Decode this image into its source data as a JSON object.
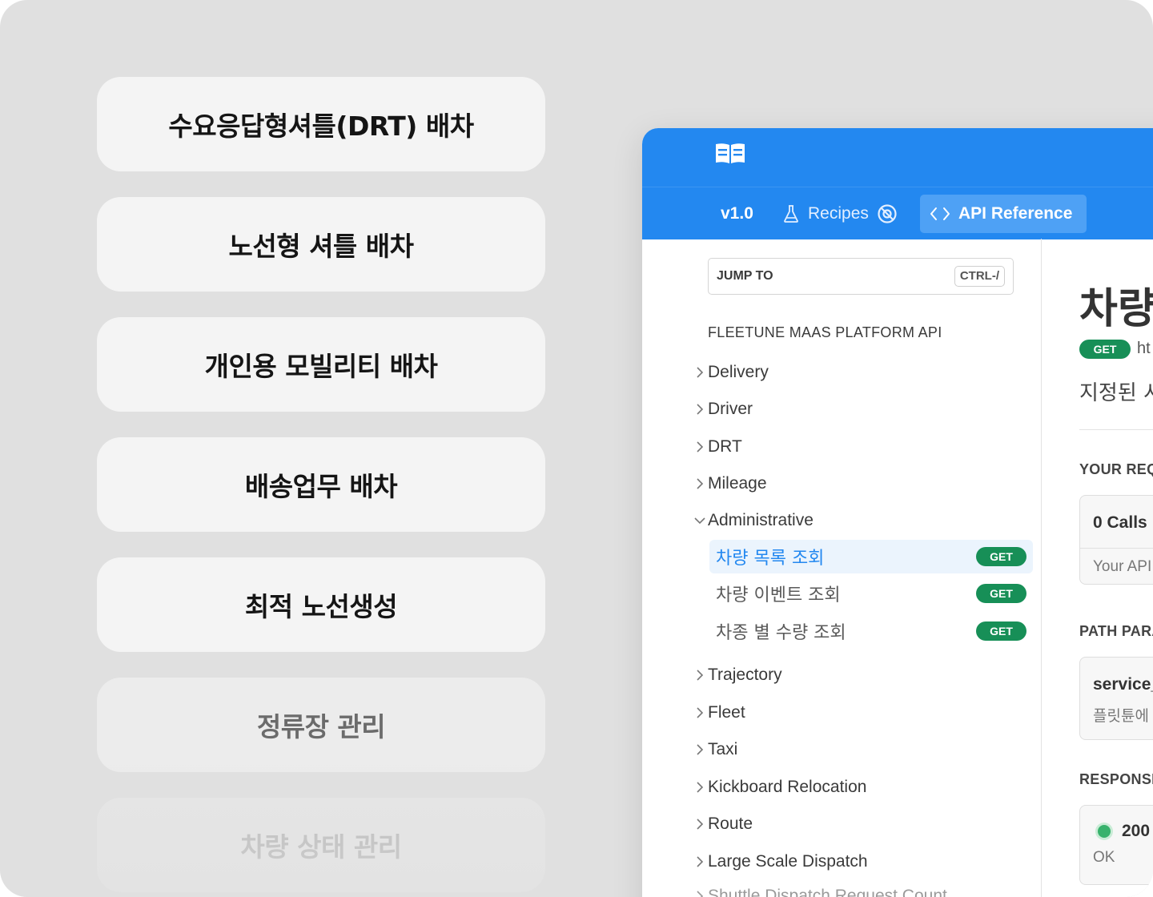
{
  "menu": {
    "items": [
      {
        "label": "수요응답형셔틀(DRT) 배차"
      },
      {
        "label": "노선형 셔틀 배차"
      },
      {
        "label": "개인용 모빌리티 배차"
      },
      {
        "label": "배송업무 배차"
      },
      {
        "label": "최적 노선생성"
      },
      {
        "label": "정류장 관리"
      },
      {
        "label": "차량 상태 관리"
      }
    ]
  },
  "docs": {
    "nav": {
      "version": "v1.0",
      "recipes": "Recipes",
      "api_reference": "API Reference"
    },
    "sidebar": {
      "jump_label": "JUMP TO",
      "jump_shortcut": "CTRL-/",
      "section_title": "FLEETUNE MAAS PLATFORM API",
      "items_before": [
        {
          "label": "Delivery"
        },
        {
          "label": "Driver"
        },
        {
          "label": "DRT"
        },
        {
          "label": "Mileage"
        }
      ],
      "expanded": {
        "label": "Administrative",
        "children": [
          {
            "label": "차량 목록 조회",
            "method": "GET",
            "active": true
          },
          {
            "label": "차량 이벤트 조회",
            "method": "GET",
            "active": false
          },
          {
            "label": "차종 별 수량 조회",
            "method": "GET",
            "active": false
          }
        ]
      },
      "items_after": [
        {
          "label": "Trajectory"
        },
        {
          "label": "Fleet"
        },
        {
          "label": "Taxi"
        },
        {
          "label": "Kickboard Relocation"
        },
        {
          "label": "Route"
        },
        {
          "label": "Large Scale Dispatch"
        },
        {
          "label": "Shuttle Dispatch Request Count"
        }
      ]
    },
    "main": {
      "title": "차량",
      "method": "GET",
      "endpoint": "ht",
      "description": "지정된 시",
      "your_requests_title": "YOUR REQ",
      "calls": "0 Calls",
      "calls_sub": "Your API",
      "path_params_title": "PATH PARA",
      "param_name": "service_",
      "param_desc": "플릿튠에",
      "responses_title": "RESPONSE",
      "status_code": "200",
      "status_text": "OK"
    }
  },
  "colors": {
    "brand_blue": "#2388f0",
    "get_green": "#178f57",
    "active_bg": "#ebf4fd"
  }
}
